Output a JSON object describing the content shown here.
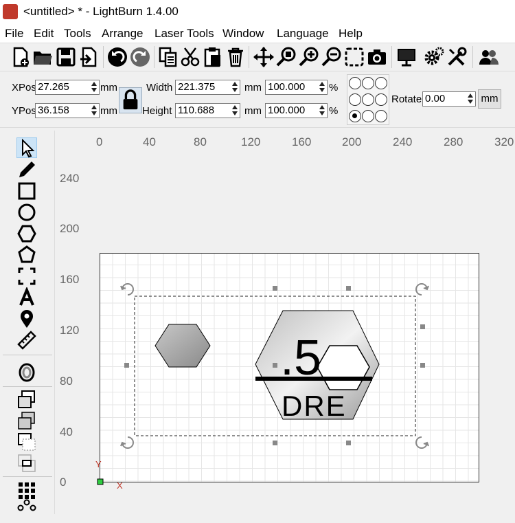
{
  "window": {
    "title": "<untitled> * - LightBurn 1.4.00"
  },
  "menu": [
    "File",
    "Edit",
    "Tools",
    "Arrange",
    "Laser Tools",
    "Window",
    "Language",
    "Help"
  ],
  "toolbar": {
    "icons": [
      "new-file-icon",
      "open-folder-icon",
      "save-icon",
      "import-icon",
      "undo-icon",
      "redo-icon",
      "copy-icon",
      "cut-icon",
      "paste-icon",
      "delete-icon",
      "move-icon",
      "zoom-selection-icon",
      "zoom-in-icon",
      "zoom-out-icon",
      "frame-icon",
      "camera-icon",
      "monitor-icon",
      "settings-icon",
      "tools-icon",
      "users-icon"
    ]
  },
  "props": {
    "xpos_label": "XPos",
    "xpos": "27.265",
    "ypos_label": "YPos",
    "ypos": "36.158",
    "unit": "mm",
    "width_label": "Width",
    "width": "221.375",
    "height_label": "Height",
    "height": "110.688",
    "wpct": "100.000",
    "hpct": "100.000",
    "pct": "%",
    "rotate_label": "Rotate",
    "rotate": "0.00",
    "mm_button": "mm"
  },
  "left_tools": [
    "select-arrow-icon",
    "pen-icon",
    "rectangle-icon",
    "ellipse-icon",
    "polygon-icon",
    "edit-nodes-icon",
    "frame-corners-icon",
    "text-icon",
    "position-marker-icon",
    "measure-icon",
    "offset-icon",
    "weld-icon",
    "union-icon",
    "subtract-icon",
    "intersect-icon",
    "grid-array-icon",
    "circular-array-icon"
  ],
  "ruler": {
    "x": [
      "0",
      "40",
      "80",
      "120",
      "160",
      "200",
      "240",
      "280",
      "320"
    ],
    "y": [
      "240",
      "200",
      "160",
      "120",
      "80",
      "40",
      "0"
    ]
  },
  "canvas": {
    "x_axis": "X",
    "y_axis": "Y",
    "design_text_top": ".5",
    "design_text_bottom": "DRE"
  },
  "colors": {
    "accent": "#c0392b",
    "selection": "#cce4f7"
  }
}
